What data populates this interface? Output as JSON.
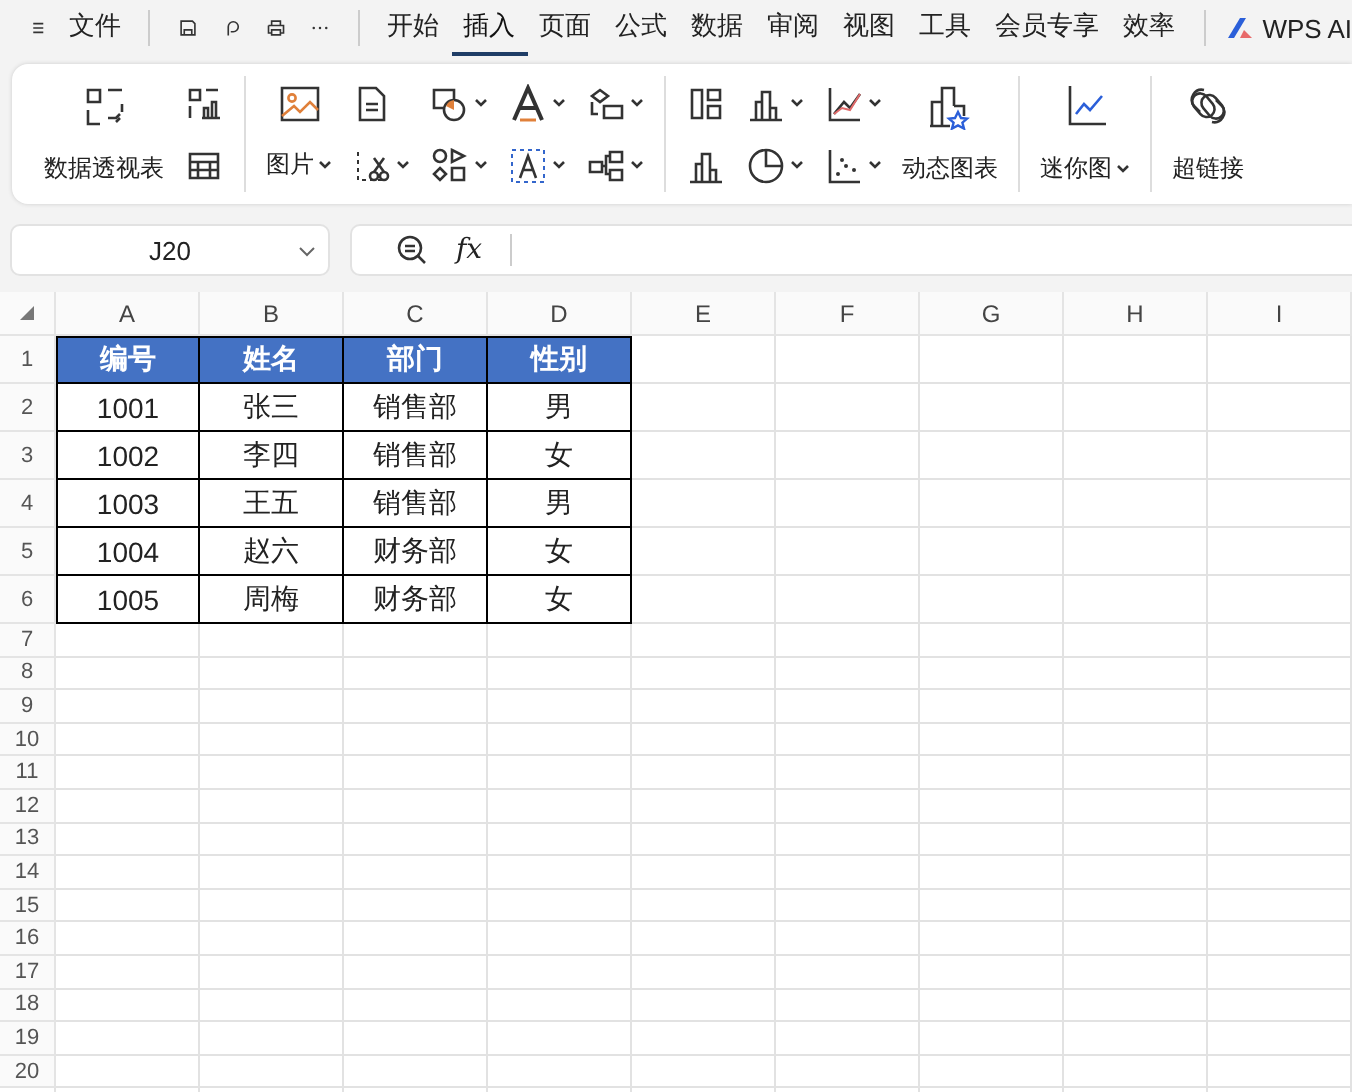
{
  "menu_bar": {
    "menu_label": "文件",
    "tabs": [
      {
        "label": "开始",
        "selected": false
      },
      {
        "label": "插入",
        "selected": true
      },
      {
        "label": "页面",
        "selected": false
      },
      {
        "label": "公式",
        "selected": false
      },
      {
        "label": "数据",
        "selected": false
      },
      {
        "label": "审阅",
        "selected": false
      },
      {
        "label": "视图",
        "selected": false
      },
      {
        "label": "工具",
        "selected": false
      },
      {
        "label": "会员专享",
        "selected": false
      },
      {
        "label": "效率",
        "selected": false
      }
    ],
    "ai_label": "WPS AI"
  },
  "ribbon": {
    "buttons": [
      {
        "label": "数据透视表"
      },
      {
        "label": "图片"
      },
      {
        "label": "动态图表"
      },
      {
        "label": "迷你图"
      },
      {
        "label": "超链接"
      }
    ]
  },
  "formula_bar": {
    "name_box": "J20",
    "function_label": "fx"
  },
  "sheet": {
    "columns": [
      "A",
      "B",
      "C",
      "D",
      "E",
      "F",
      "G",
      "H",
      "I"
    ],
    "rows": [
      "1",
      "2",
      "3",
      "4",
      "5",
      "6",
      "7",
      "8",
      "9",
      "10",
      "11",
      "12",
      "13",
      "14",
      "15",
      "16",
      "17",
      "18",
      "19",
      "20"
    ],
    "table": {
      "header": [
        "编号",
        "姓名",
        "部门",
        "性别"
      ],
      "rows": [
        [
          "1001",
          "张三",
          "销售部",
          "男"
        ],
        [
          "1002",
          "李四",
          "销售部",
          "女"
        ],
        [
          "1003",
          "王五",
          "销售部",
          "男"
        ],
        [
          "1004",
          "赵六",
          "财务部",
          "女"
        ],
        [
          "1005",
          "周梅",
          "财务部",
          "女"
        ]
      ]
    }
  }
}
